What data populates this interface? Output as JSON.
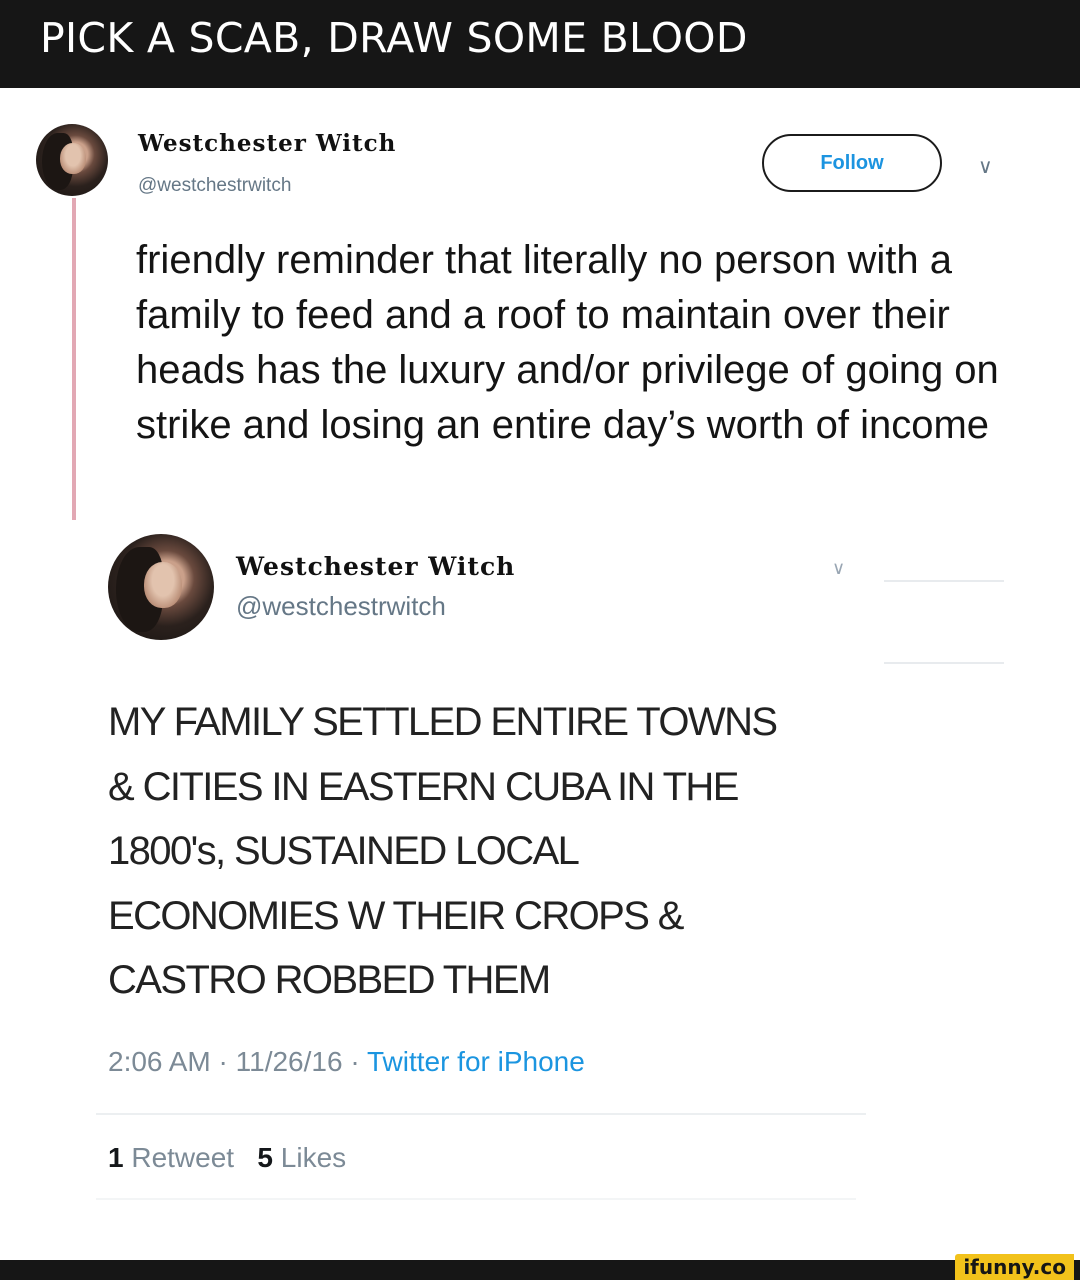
{
  "banner": {
    "title": "PICK A SCAB, DRAW SOME BLOOD"
  },
  "tweet1": {
    "display_name": "Westchester Witch",
    "handle": "@westchestrwitch",
    "follow_label": "Follow",
    "menu_icon": "chevron-down-icon",
    "text": "friendly reminder that literally no person with a family to feed and a roof to maintain over their heads has the luxury and/or privilege of going on strike and losing an entire day’s worth of income"
  },
  "tweet2": {
    "display_name": "Westchester Witch",
    "handle": "@westchestrwitch",
    "menu_icon": "chevron-down-icon",
    "text_lines": [
      "MY FAMILY SETTLED ENTIRE TOWNS",
      "& CITIES IN EASTERN CUBA IN THE",
      "1800's, SUSTAINED LOCAL",
      "ECONOMIES W THEIR CROPS &",
      "CASTRO ROBBED THEM"
    ],
    "time": "2:06 AM",
    "date": "11/26/16",
    "separator": "·",
    "source": "Twitter for iPhone",
    "retweets_count": "1",
    "retweets_label": "Retweet",
    "likes_count": "5",
    "likes_label": "Likes"
  },
  "watermark": {
    "text": "ifunny.co"
  },
  "colors": {
    "banner_bg": "#161616",
    "link_blue": "#1b95e0",
    "thread_line": "#e2a8b4",
    "watermark_bg": "#f2c21b"
  }
}
